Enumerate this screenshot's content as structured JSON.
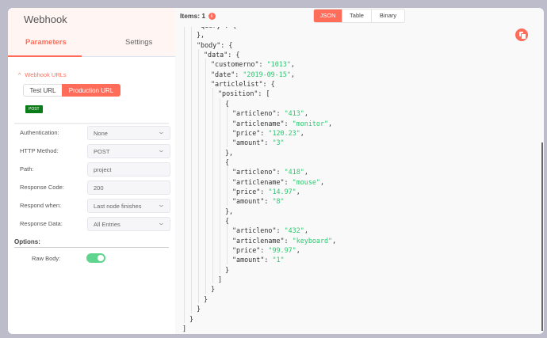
{
  "left": {
    "title": "Webhook",
    "tabs": [
      "Parameters",
      "Settings"
    ],
    "webhook_urls_label": "Webhook URLs",
    "url_buttons": [
      "Test URL",
      "Production URL"
    ],
    "method_badge": "POST",
    "fields": [
      {
        "label": "Authentication:",
        "value": "None",
        "dropdown": true
      },
      {
        "label": "HTTP Method:",
        "value": "POST",
        "dropdown": true
      },
      {
        "label": "Path:",
        "value": "project",
        "dropdown": false
      },
      {
        "label": "Response Code:",
        "value": "200",
        "dropdown": false
      },
      {
        "label": "Respond when:",
        "value": "Last node finishes",
        "dropdown": true
      },
      {
        "label": "Response Data:",
        "value": "All Entries",
        "dropdown": true
      }
    ],
    "options_label": "Options:",
    "raw_body_label": "Raw Body:",
    "raw_body_on": true
  },
  "right": {
    "items_label": "Items: 1",
    "info_icon": "i",
    "views": [
      "JSON",
      "Table",
      "Binary"
    ],
    "active_view": "JSON",
    "json_lines": [
      {
        "level": 2,
        "key": "query",
        "open": "{"
      },
      {
        "level": 2,
        "text": "},"
      },
      {
        "level": 2,
        "key": "body",
        "open": "{"
      },
      {
        "level": 3,
        "key": "data",
        "open": "{"
      },
      {
        "level": 4,
        "key": "customerno",
        "value": "1013",
        "comma": true
      },
      {
        "level": 4,
        "key": "date",
        "value": "2019-09-15",
        "comma": true
      },
      {
        "level": 4,
        "key": "articlelist",
        "open": "{"
      },
      {
        "level": 5,
        "key": "position",
        "open": "["
      },
      {
        "level": 6,
        "text": "{"
      },
      {
        "level": 7,
        "key": "articleno",
        "value": "413",
        "comma": true
      },
      {
        "level": 7,
        "key": "articlename",
        "value": "monitor",
        "comma": true
      },
      {
        "level": 7,
        "key": "price",
        "value": "120.23",
        "comma": true
      },
      {
        "level": 7,
        "key": "amount",
        "value": "3"
      },
      {
        "level": 6,
        "text": "},"
      },
      {
        "level": 6,
        "text": "{"
      },
      {
        "level": 7,
        "key": "articleno",
        "value": "418",
        "comma": true
      },
      {
        "level": 7,
        "key": "articlename",
        "value": "mouse",
        "comma": true
      },
      {
        "level": 7,
        "key": "price",
        "value": "14.97",
        "comma": true
      },
      {
        "level": 7,
        "key": "amount",
        "value": "8"
      },
      {
        "level": 6,
        "text": "},"
      },
      {
        "level": 6,
        "text": "{"
      },
      {
        "level": 7,
        "key": "articleno",
        "value": "432",
        "comma": true
      },
      {
        "level": 7,
        "key": "articlename",
        "value": "keyboard",
        "comma": true
      },
      {
        "level": 7,
        "key": "price",
        "value": "99.97",
        "comma": true
      },
      {
        "level": 7,
        "key": "amount",
        "value": "1"
      },
      {
        "level": 6,
        "text": "}"
      },
      {
        "level": 5,
        "text": "]"
      },
      {
        "level": 4,
        "text": "}"
      },
      {
        "level": 3,
        "text": "}"
      },
      {
        "level": 2,
        "text": "}"
      },
      {
        "level": 1,
        "text": "}"
      },
      {
        "level": 0,
        "text": "]"
      }
    ]
  },
  "colors": {
    "accent": "#ff6d5a",
    "string": "#2fc770",
    "toggle": "#5fd48c",
    "badge": "#0a7d18"
  }
}
